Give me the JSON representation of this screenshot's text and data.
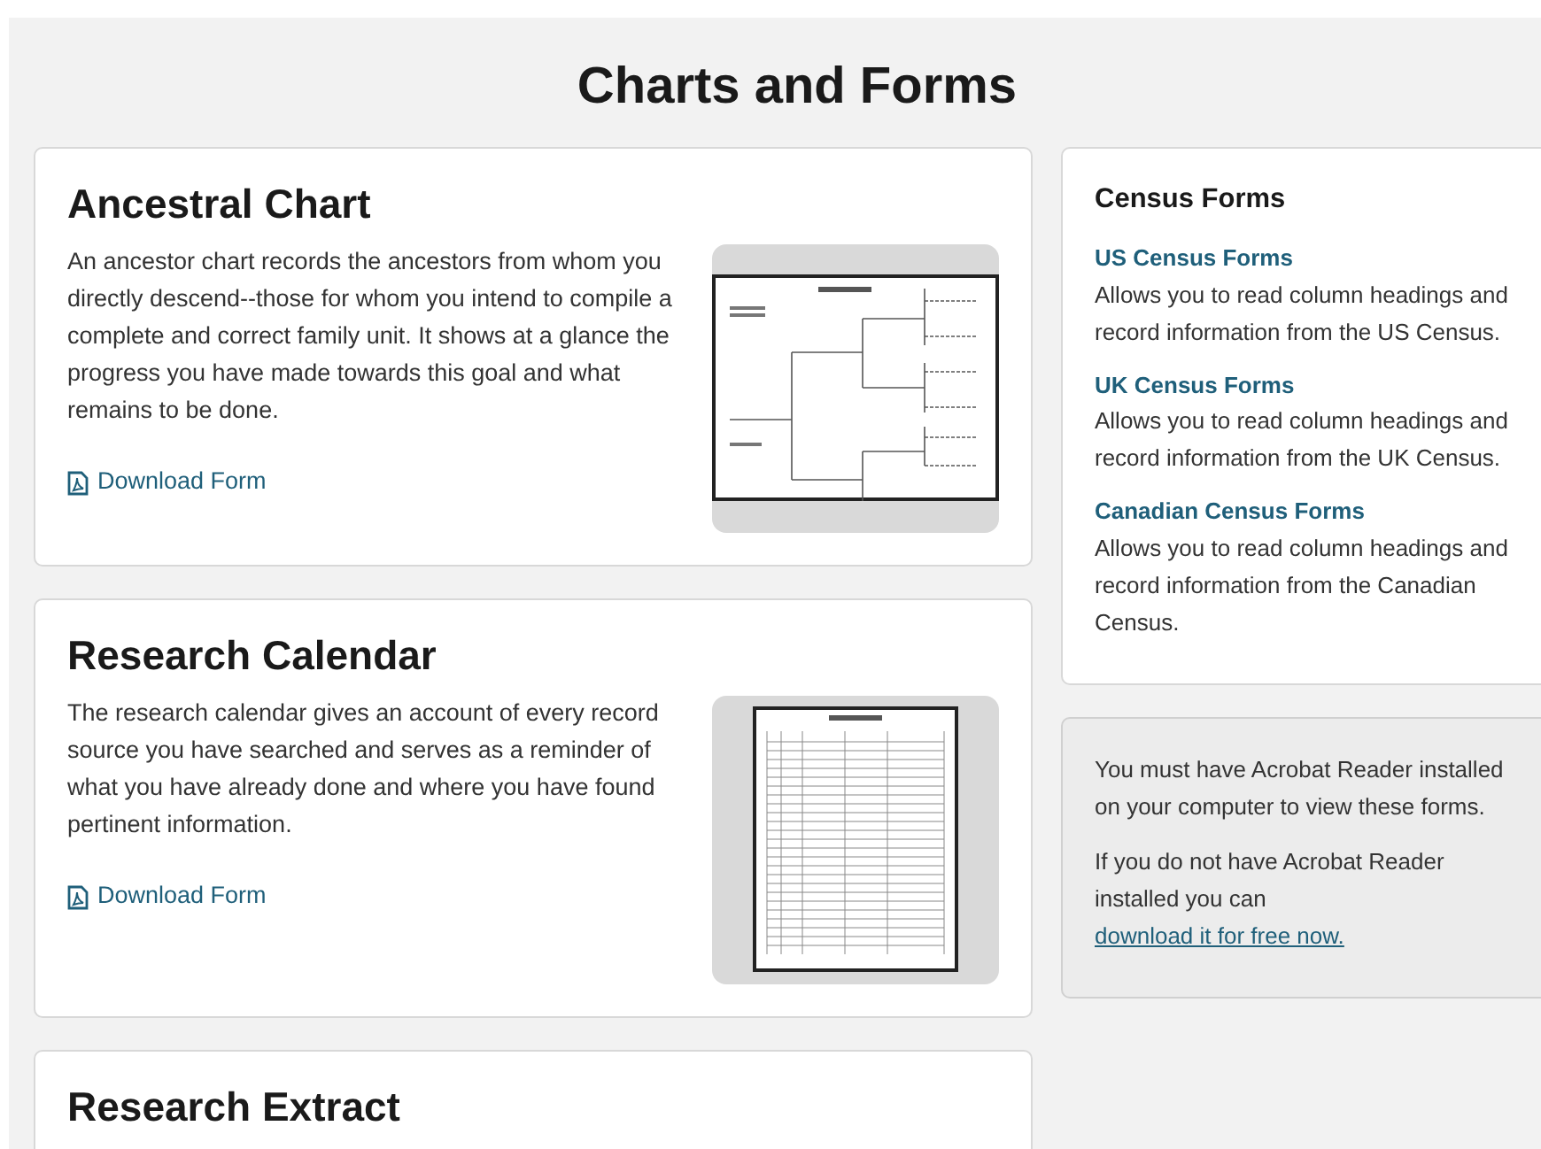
{
  "page_title": "Charts and Forms",
  "forms": [
    {
      "title": "Ancestral Chart",
      "description": "An ancestor chart records the ancestors from whom you directly descend--those for whom you intend to compile a complete and correct family unit. It shows at a glance the progress you have made towards this goal and what remains to be done.",
      "link": "Download Form",
      "kind": "pedigree"
    },
    {
      "title": "Research Calendar",
      "description": "The research calendar gives an account of every record source you have searched and serves as a reminder of what you have already done and where you have found pertinent information.",
      "link": "Download Form",
      "kind": "calendar"
    },
    {
      "title": "Research Extract"
    }
  ],
  "census": {
    "heading": "Census Forms",
    "items": [
      {
        "link": "US Census Forms",
        "description": "Allows you to read column headings and record information from the US Census."
      },
      {
        "link": "UK Census Forms",
        "description": "Allows you to read column headings and record information from the UK Census."
      },
      {
        "link": "Canadian Census Forms",
        "description": "Allows you to read column headings and record information from the Canadian Census."
      }
    ]
  },
  "note": {
    "paragraph": "You must have Acrobat Reader installed on your computer to view these forms.",
    "text": "If you do not have Acrobat Reader installed you can",
    "link": "download it for free now."
  }
}
